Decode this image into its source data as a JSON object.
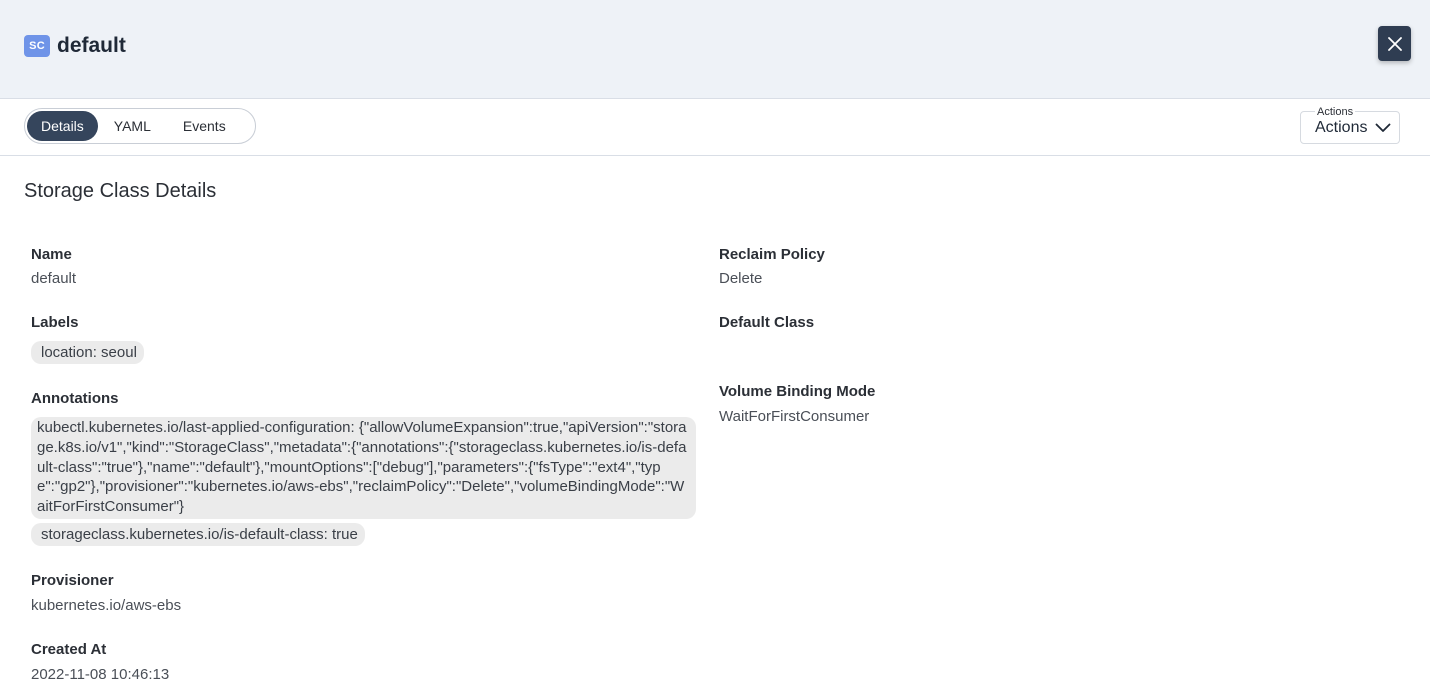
{
  "header": {
    "badge": "SC",
    "title": "default",
    "close_icon": "close-icon"
  },
  "tabs": [
    {
      "label": "Details",
      "active": true
    },
    {
      "label": "YAML",
      "active": false
    },
    {
      "label": "Events",
      "active": false
    }
  ],
  "actions": {
    "caption": "Actions",
    "label": "Actions",
    "icon": "chevron-down-icon"
  },
  "section_title": "Storage Class Details",
  "fields": {
    "name": {
      "label": "Name",
      "value": "default"
    },
    "labels": {
      "label": "Labels",
      "chips": [
        "location: seoul"
      ]
    },
    "annotations": {
      "label": "Annotations",
      "chips": [
        "kubectl.kubernetes.io/last-applied-configuration: {\"allowVolumeExpansion\":true,\"apiVersion\":\"storage.k8s.io/v1\",\"kind\":\"StorageClass\",\"metadata\":{\"annotations\":{\"storageclass.kubernetes.io/is-default-class\":\"true\"},\"name\":\"default\"},\"mountOptions\":[\"debug\"],\"parameters\":{\"fsType\":\"ext4\",\"type\":\"gp2\"},\"provisioner\":\"kubernetes.io/aws-ebs\",\"reclaimPolicy\":\"Delete\",\"volumeBindingMode\":\"WaitForFirstConsumer\"}",
        "storageclass.kubernetes.io/is-default-class: true"
      ]
    },
    "provisioner": {
      "label": "Provisioner",
      "value": "kubernetes.io/aws-ebs"
    },
    "created_at": {
      "label": "Created At",
      "value": "2022-11-08 10:46:13"
    },
    "reclaim_policy": {
      "label": "Reclaim Policy",
      "value": "Delete"
    },
    "default_class": {
      "label": "Default Class",
      "value": ""
    },
    "volume_binding_mode": {
      "label": "Volume Binding Mode",
      "value": "WaitForFirstConsumer"
    }
  },
  "colors": {
    "header_bg": "#eef2f7",
    "badge_bg": "#6f94e8",
    "active_tab_bg": "#35455c",
    "close_bg": "#2f3d52",
    "chip_bg": "#ebebeb"
  }
}
